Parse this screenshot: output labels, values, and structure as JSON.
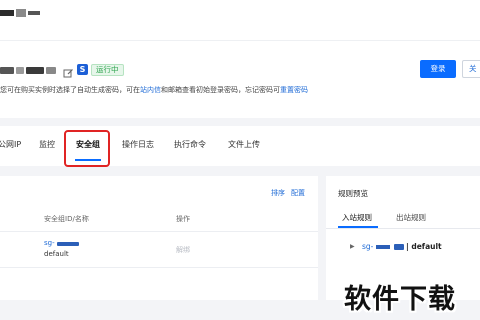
{
  "header": {
    "status": "运行中",
    "hint_prefix": "您可在购买实例时选择了自动生成密码，可在",
    "hint_link1": "站内信",
    "hint_middle": "和邮箱查看初始登录密码，忘记密码可",
    "hint_link2": "重置密码",
    "login_label": "登录",
    "more_label": "关"
  },
  "tabs": [
    {
      "label": "公网IP"
    },
    {
      "label": "监控"
    },
    {
      "label": "安全组"
    },
    {
      "label": "操作日志"
    },
    {
      "label": "执行命令"
    },
    {
      "label": "文件上传"
    }
  ],
  "security_group": {
    "actions": {
      "sort": "排序",
      "config": "配置"
    },
    "columns": {
      "id_name": "安全组ID/名称",
      "operation": "操作"
    },
    "rows": [
      {
        "id_prefix": "sg-",
        "name": "default",
        "action": "解绑"
      }
    ]
  },
  "rules_preview": {
    "title": "规则预览",
    "tabs": [
      "入站规则",
      "出站规则"
    ],
    "rule_id_prefix": "sg-",
    "rule_name": "| default"
  },
  "watermark": "软件下载",
  "colors": {
    "accent": "#0a6cff",
    "link": "#1f6bd6",
    "status_green": "#2ba24c",
    "highlight_red": "#e02424"
  }
}
